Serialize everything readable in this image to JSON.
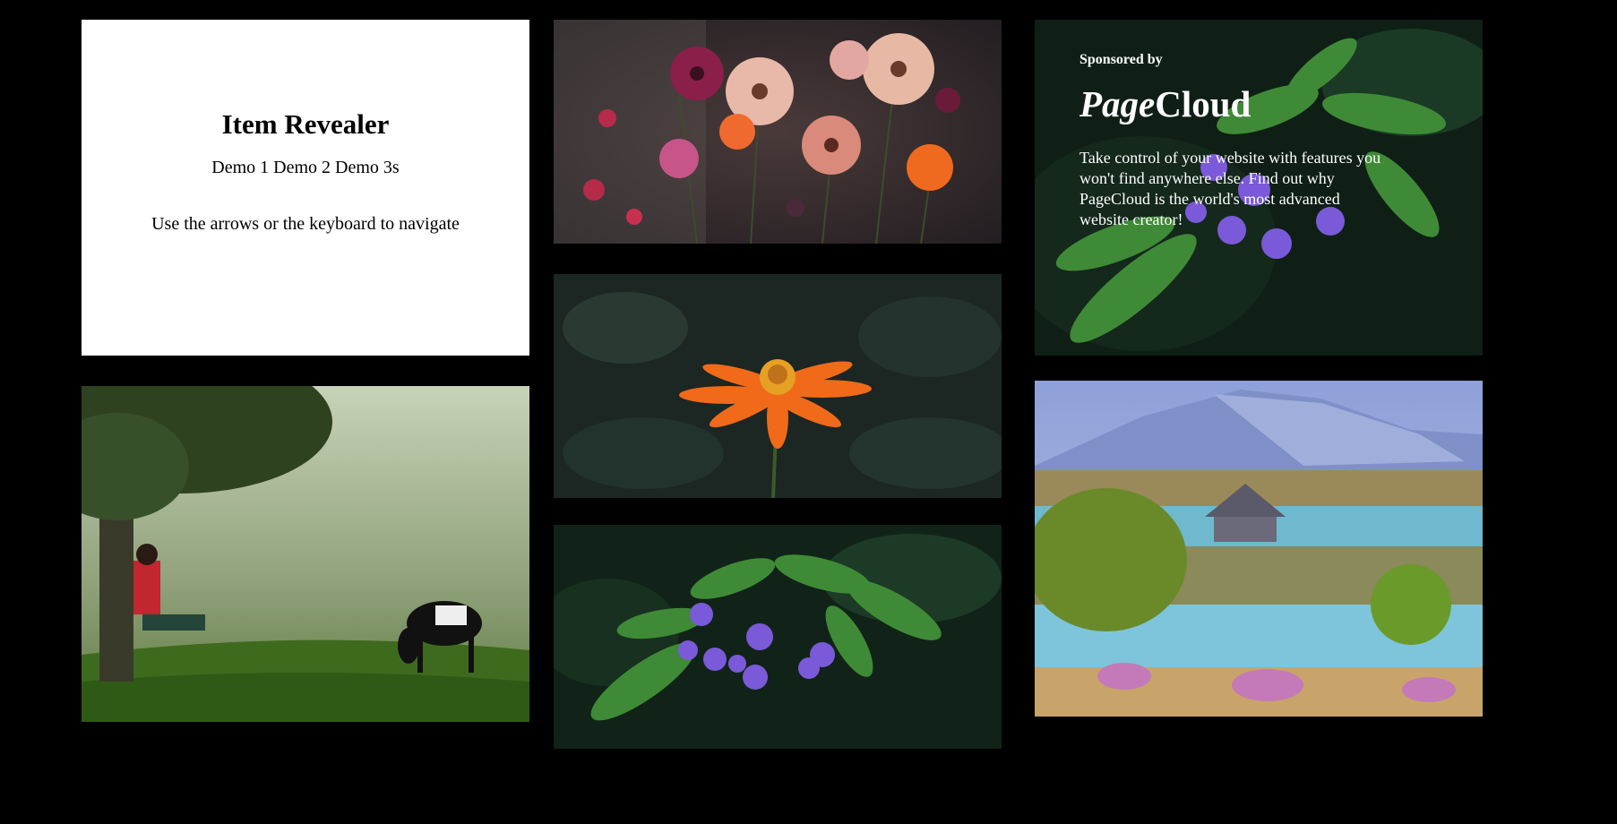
{
  "intro": {
    "title": "Item Revealer",
    "demos": [
      "Demo 1",
      "Demo 2",
      "Demo 3s"
    ],
    "hint": "Use the arrows or the keyboard to navigate"
  },
  "sponsor": {
    "sponsored_by": "Sponsored by",
    "brand_part1": "Page",
    "brand_part2": "Cloud",
    "blurb": "Take control of your website with features you won't find anywhere else. Find out why PageCloud is the world's most advanced website creator!"
  },
  "colors": {
    "background": "#000000",
    "card": "#ffffff",
    "text_dark": "#000000",
    "text_light": "#ffffff"
  }
}
